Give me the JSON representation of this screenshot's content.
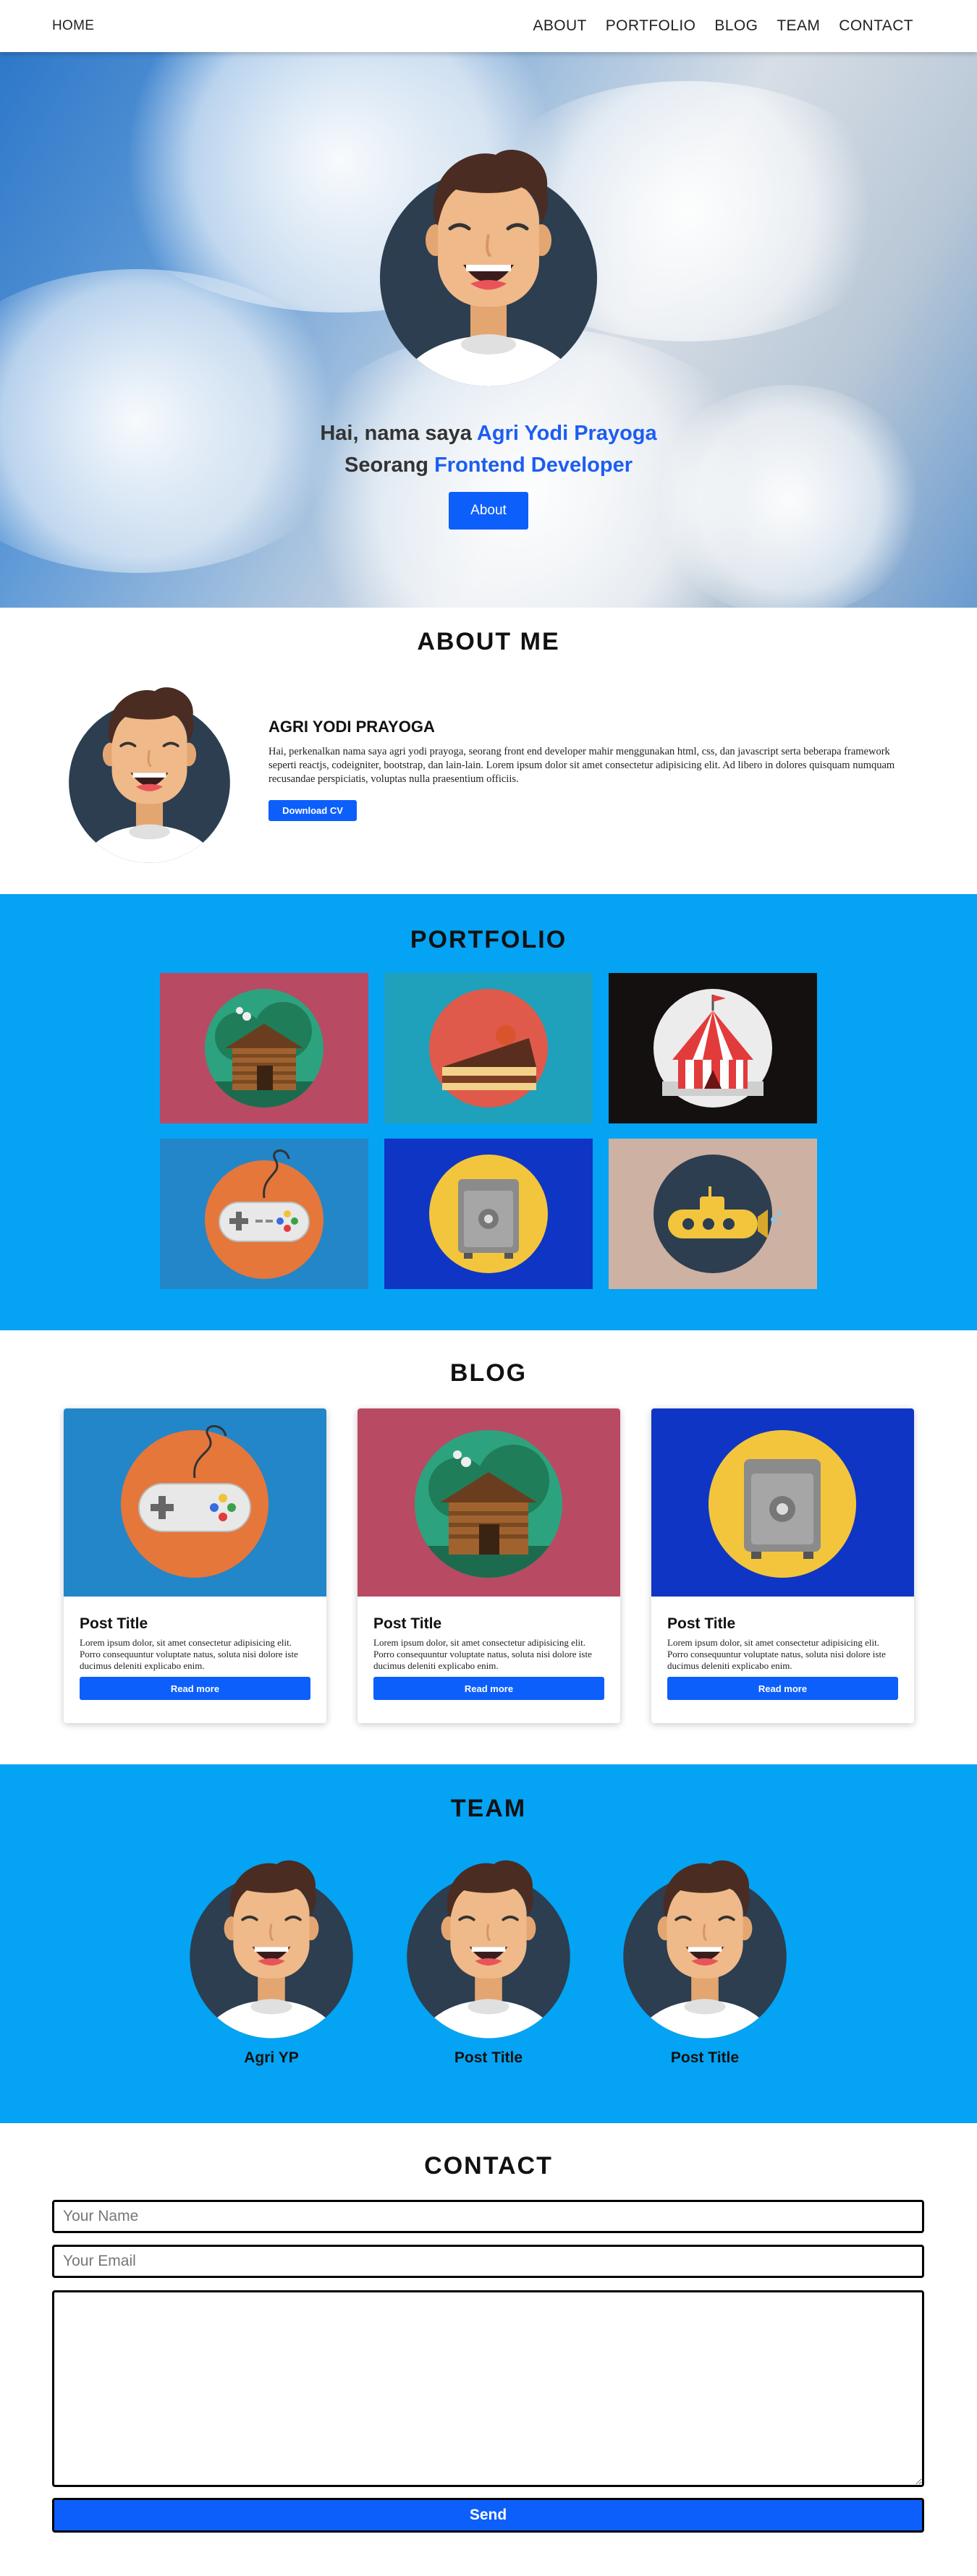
{
  "nav": {
    "home": "HOME",
    "links": [
      "ABOUT",
      "PORTFOLIO",
      "BLOG",
      "TEAM",
      "CONTACT"
    ]
  },
  "hero": {
    "line1_prefix": "Hai, nama saya ",
    "line1_name": "Agri Yodi Prayoga",
    "line2_prefix": "Seorang ",
    "line2_role": "Frontend Developer",
    "button": "About"
  },
  "about": {
    "title": "ABOUT ME",
    "name": "AGRI YODI PRAYOGA",
    "text": "Hai, perkenalkan nama saya agri yodi prayoga, seorang front end developer mahir menggunakan html, css, dan javascript serta beberapa framework seperti reactjs, codeigniter, bootstrap, dan lain-lain. Lorem ipsum dolor sit amet consectetur adipisicing elit. Ad libero in dolores quisquam numquam recusandae perspiciatis, voluptas nulla praesentium officiis.",
    "button": "Download CV"
  },
  "portfolio": {
    "title": "PORTFOLIO",
    "items": [
      {
        "icon": "cabin-icon",
        "bg": "#b94a63"
      },
      {
        "icon": "cake-icon",
        "bg": "#1fa0bb"
      },
      {
        "icon": "circus-tent-icon",
        "bg": "#141010"
      },
      {
        "icon": "game-controller-icon",
        "bg": "#2286c8"
      },
      {
        "icon": "safe-icon",
        "bg": "#0f35c4"
      },
      {
        "icon": "submarine-icon",
        "bg": "#cdb1a3"
      }
    ]
  },
  "blog": {
    "title": "BLOG",
    "posts": [
      {
        "title": "Post Title",
        "text": "Lorem ipsum dolor, sit amet consectetur adipisicing elit. Porro consequuntur voluptate natus, soluta nisi dolore iste ducimus deleniti explicabo enim.",
        "button": "Read more",
        "icon": "game-controller-icon"
      },
      {
        "title": "Post Title",
        "text": "Lorem ipsum dolor, sit amet consectetur adipisicing elit. Porro consequuntur voluptate natus, soluta nisi dolore iste ducimus deleniti explicabo enim.",
        "button": "Read more",
        "icon": "cabin-icon"
      },
      {
        "title": "Post Title",
        "text": "Lorem ipsum dolor, sit amet consectetur adipisicing elit. Porro consequuntur voluptate natus, soluta nisi dolore iste ducimus deleniti explicabo enim.",
        "button": "Read more",
        "icon": "safe-icon"
      }
    ]
  },
  "team": {
    "title": "TEAM",
    "members": [
      {
        "name": "Agri YP"
      },
      {
        "name": "Post Title"
      },
      {
        "name": "Post Title"
      }
    ]
  },
  "contact": {
    "title": "CONTACT",
    "name_placeholder": "Your Name",
    "email_placeholder": "Your Email",
    "message_placeholder": "",
    "button": "Send"
  },
  "colors": {
    "accent": "#0d5ffc",
    "section_blue": "#04a3f3"
  }
}
